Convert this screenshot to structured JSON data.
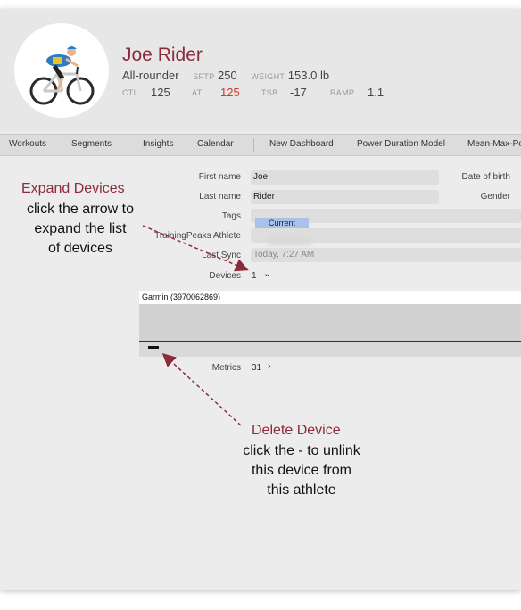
{
  "athlete": {
    "name": "Joe Rider",
    "type": "All-rounder",
    "sftp_label": "SFTP",
    "sftp": "250",
    "weight_label": "WEIGHT",
    "weight": "153.0 lb",
    "ctl_label": "CTL",
    "ctl": "125",
    "atl_label": "ATL",
    "atl": "125",
    "tsb_label": "TSB",
    "tsb": "-17",
    "ramp_label": "RAMP",
    "ramp": "1.1"
  },
  "tabs": [
    "Workouts",
    "Segments",
    "Insights",
    "Calendar",
    "New Dashboard",
    "Power Duration Model",
    "Mean-Max-Po"
  ],
  "form": {
    "first_name_label": "First name",
    "first_name": "Joe",
    "last_name_label": "Last name",
    "last_name": "Rider",
    "tags_label": "Tags",
    "tag": "Current",
    "tp_label": "TrainingPeaks Athlete",
    "last_sync_label": "Last Sync",
    "last_sync": "Today, 7:27 AM",
    "devices_label": "Devices",
    "devices_count": "1",
    "devices_chevron": "⌄",
    "dob_label": "Date of birth",
    "gender_label": "Gender",
    "metrics_label": "Metrics",
    "metrics_count": "31",
    "metrics_chevron": "›"
  },
  "devices": {
    "items": [
      "Garmin  (3970062869)"
    ],
    "remove_symbol": "−"
  },
  "annotations": {
    "expand_title": "Expand Devices",
    "expand_body": [
      "click the arrow to",
      "expand the list",
      "of devices"
    ],
    "delete_title": "Delete Device",
    "delete_body": [
      "click the - to unlink",
      "this device from",
      "this athlete"
    ]
  },
  "colors": {
    "accent": "#8b2b3c",
    "atl": "#d0392b",
    "tag": "#a9c2ea"
  }
}
